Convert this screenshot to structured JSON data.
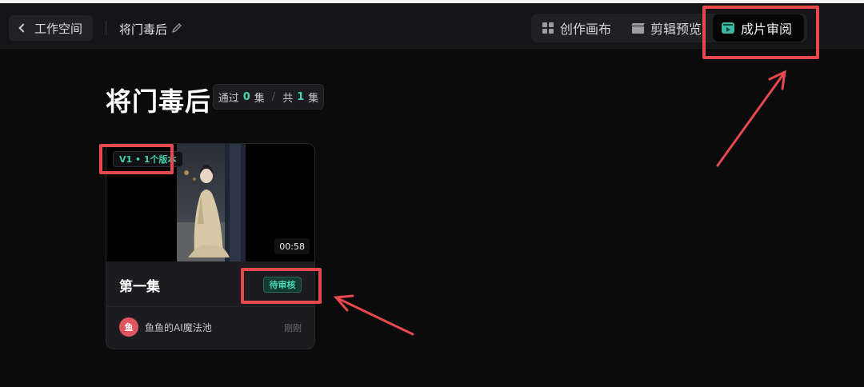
{
  "topbar": {
    "back_label": "工作空间",
    "project_name": "将门毒后",
    "tabs": [
      {
        "label": "创作画布",
        "icon": "grid-icon"
      },
      {
        "label": "剪辑预览",
        "icon": "clapperboard-icon"
      },
      {
        "label": "成片审阅",
        "icon": "review-icon",
        "active": true
      }
    ]
  },
  "main": {
    "title": "将门毒后",
    "stats": {
      "passed_label": "通过",
      "passed": "0",
      "passed_unit": "集",
      "total_label": "共",
      "total": "1",
      "total_unit": "集"
    }
  },
  "card": {
    "version": "V1 • 1个版本",
    "duration": "00:58",
    "title": "第一集",
    "status": "待审核",
    "avatar_char": "鱼",
    "author": "鱼鱼的AI魔法池",
    "time": "刚刚"
  },
  "colors": {
    "accent": "#3fd1ae",
    "highlight": "#e5484d",
    "avatar": "#e0555d"
  }
}
